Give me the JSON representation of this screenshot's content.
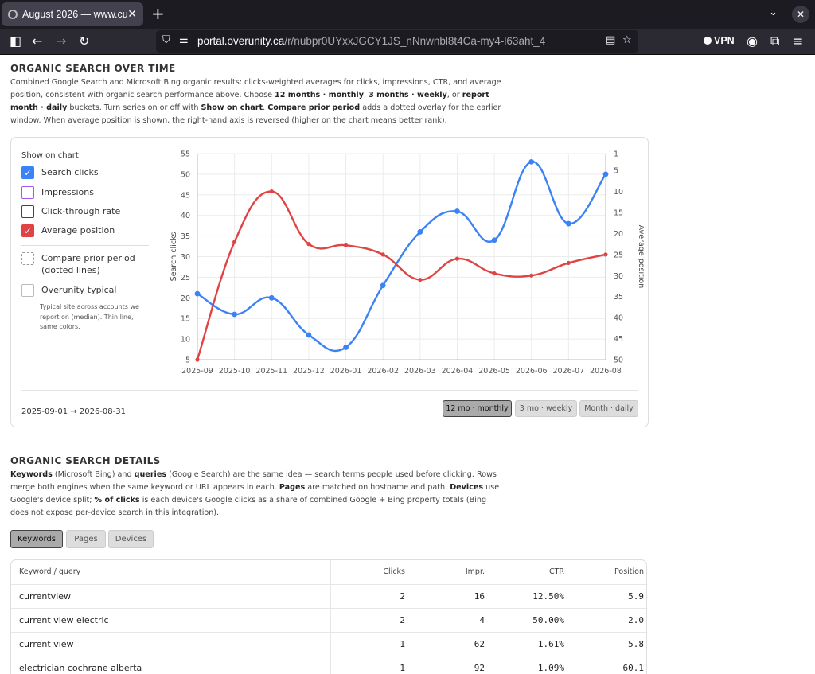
{
  "browser": {
    "tab_title": "August 2026 — www.cu",
    "url_host": "portal.overunity.ca",
    "url_path": "/r/nubpr0UYxxJGCY1JS_nNnwnbl8t4Ca-my4-l63aht_4",
    "vpn_label": "VPN"
  },
  "over_time": {
    "title": "ORGANIC SEARCH OVER TIME",
    "desc": [
      {
        "t": "Combined Google Search and Microsoft Bing organic results: clicks-weighted averages for clicks, impressions, CTR, and average position, consistent with organic search performance above. Choose "
      },
      {
        "t": "12 months · monthly",
        "b": true
      },
      {
        "t": ", "
      },
      {
        "t": "3 months · weekly",
        "b": true
      },
      {
        "t": ", or "
      },
      {
        "t": "report month · daily",
        "b": true
      },
      {
        "t": " buckets. Turn series on or off with "
      },
      {
        "t": "Show on chart",
        "b": true
      },
      {
        "t": ". "
      },
      {
        "t": "Compare prior period",
        "b": true
      },
      {
        "t": " adds a dotted overlay for the earlier window. When average position is shown, the right-hand axis is reversed (higher on the chart means better rank)."
      }
    ],
    "show_on_chart": "Show on chart",
    "toggles": [
      {
        "label": "Search clicks",
        "checked": true,
        "color": "#3b82f6"
      },
      {
        "label": "Impressions",
        "checked": false,
        "color": "#a855f7"
      },
      {
        "label": "Click-through rate",
        "checked": false,
        "color": "#555555"
      },
      {
        "label": "Average position",
        "checked": true,
        "color": "#e04343"
      }
    ],
    "compare_label": "Compare prior period (dotted lines)",
    "typical_label": "Overunity typical",
    "typical_note": "Typical site across accounts we report on (median). Thin line, same colors.",
    "date_range": "2025-09-01 → 2026-08-31",
    "ranges": [
      "12 mo · monthly",
      "3 mo · weekly",
      "Month · daily"
    ],
    "active_range": 0
  },
  "chart_data": {
    "type": "line",
    "x": [
      "2025-09",
      "2025-10",
      "2025-11",
      "2025-12",
      "2026-01",
      "2026-02",
      "2026-03",
      "2026-04",
      "2026-05",
      "2026-06",
      "2026-07",
      "2026-08"
    ],
    "series": [
      {
        "name": "Search clicks",
        "axis": "left",
        "color": "#3b82f6",
        "values": [
          21,
          16,
          20,
          11,
          8,
          23,
          36,
          41,
          34,
          53,
          38,
          50
        ]
      },
      {
        "name": "Average position",
        "axis": "right",
        "color": "#e04343",
        "values": [
          50,
          22,
          10,
          22.5,
          22.8,
          25,
          31,
          26,
          29.5,
          30,
          27,
          25
        ]
      }
    ],
    "ylabel": "Search clicks",
    "ylabel_right": "Average position",
    "ylim": [
      5,
      55
    ],
    "yticks": [
      5,
      10,
      15,
      20,
      25,
      30,
      35,
      40,
      45,
      50,
      55
    ],
    "ylim_right": [
      1,
      50
    ],
    "yticks_right": [
      1,
      5,
      10,
      15,
      20,
      25,
      30,
      35,
      40,
      45,
      50
    ],
    "right_reversed": true,
    "grid": true
  },
  "details": {
    "title": "ORGANIC SEARCH DETAILS",
    "desc": [
      {
        "t": "Keywords",
        "b": true
      },
      {
        "t": " (Microsoft Bing) and "
      },
      {
        "t": "queries",
        "b": true
      },
      {
        "t": " (Google Search) are the same idea — search terms people used before clicking. Rows merge both engines when the same keyword or URL appears in each. "
      },
      {
        "t": "Pages",
        "b": true
      },
      {
        "t": " are matched on hostname and path. "
      },
      {
        "t": "Devices",
        "b": true
      },
      {
        "t": " use Google's device split; "
      },
      {
        "t": "% of clicks",
        "b": true
      },
      {
        "t": " is each device's Google clicks as a share of combined Google + Bing property totals (Bing does not expose per-device search in this integration)."
      }
    ],
    "tabs": [
      "Keywords",
      "Pages",
      "Devices"
    ],
    "active_tab": 0,
    "columns": [
      "Keyword / query",
      "Clicks",
      "Impr.",
      "CTR",
      "Position"
    ],
    "rows": [
      [
        "currentview",
        "2",
        "16",
        "12.50%",
        "5.9"
      ],
      [
        "current view electric",
        "2",
        "4",
        "50.00%",
        "2.0"
      ],
      [
        "current view",
        "1",
        "62",
        "1.61%",
        "5.8"
      ],
      [
        "electrician cochrane alberta",
        "1",
        "92",
        "1.09%",
        "60.1"
      ]
    ]
  }
}
